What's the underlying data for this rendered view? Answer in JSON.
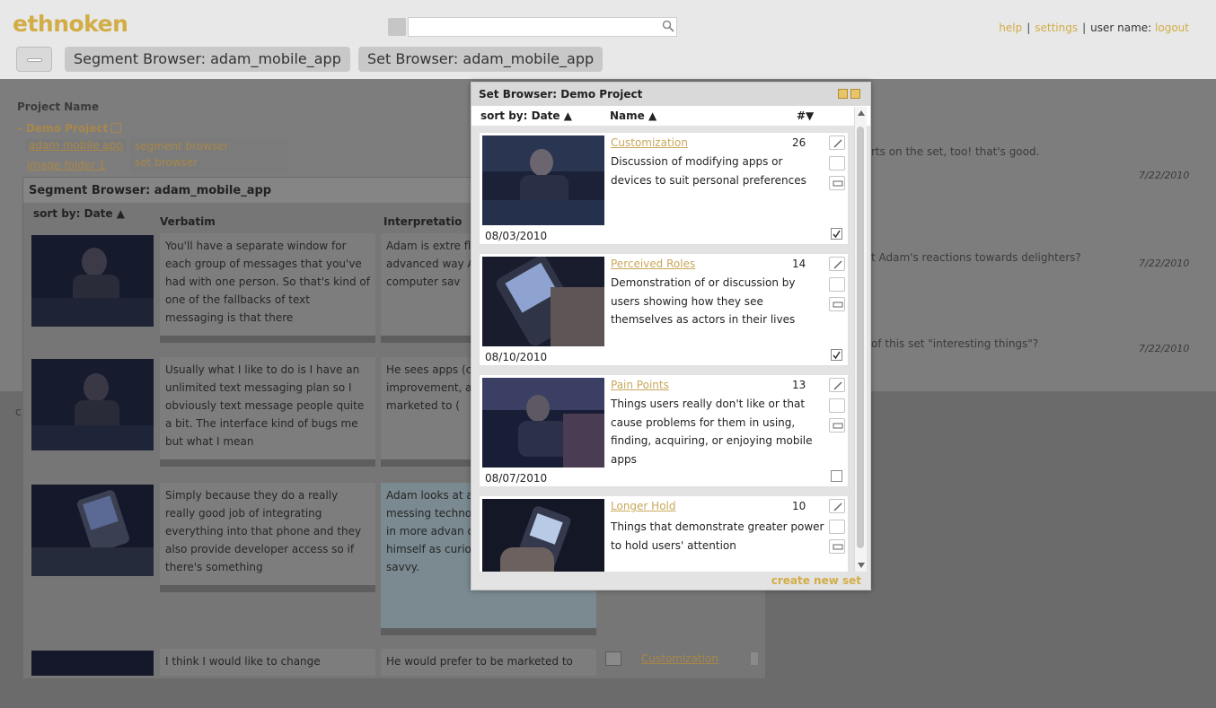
{
  "header": {
    "logo": "ethnoken",
    "search_placeholder": "",
    "links": {
      "help": "help",
      "settings": "settings",
      "user": "user name:",
      "logout": "logout"
    },
    "tabs": [
      "Segment Browser: adam_mobile_app",
      "Set Browser: adam_mobile_app"
    ]
  },
  "background": {
    "project_name_label": "Project Name",
    "project": "Demo Project",
    "items": [
      "adam mobile app",
      "image folder 1"
    ],
    "context_menu": [
      "segment browser",
      "set browser"
    ],
    "comments": [
      {
        "text": "rts on the set, too! that's good.",
        "date": "7/22/2010"
      },
      {
        "text": "t Adam's reactions towards delighters?",
        "date": "7/22/2010"
      },
      {
        "text": "of this set \"interesting things\"?",
        "date": "7/22/2010"
      }
    ],
    "stray_letter": "c"
  },
  "segment_browser": {
    "title": "Segment Browser: adam_mobile_app",
    "sort_label": "sort by: Date ▲",
    "col_verbatim": "Verbatim",
    "col_interpretation": "Interpretatio",
    "rows": [
      {
        "verbatim": "You'll have a separate window for each group of messages that you've had with one person. So that's kind of one of the fallbacks of text messaging is that there",
        "interpretation": "Adam is extre fluent and inte advanced way Adam sees hi computer sav"
      },
      {
        "verbatim": "Usually what I like to do is I have an unlimited text messaging plan so I obviously text message people quite a bit. The interface kind of bugs me but what I mean",
        "interpretation": "He sees apps (customizable improvement, and how he m marketed to ("
      },
      {
        "verbatim": "Simply because they do a really really good job of integrating everything into that phone and they also provide developer access so if there's something",
        "interpretation": "Adam looks at app and discu about messing technology ha technological in more advan devices. Adam sees himself as curious and computer savvy."
      },
      {
        "verbatim": "I think I would like to change",
        "interpretation": "He would prefer to be marketed to",
        "set": "Customization"
      }
    ]
  },
  "set_browser": {
    "title": "Set Browser: Demo Project",
    "sort_label": "sort by: Date ▲",
    "name_label": "Name ▲",
    "count_label": "#▼",
    "create_label": "create new set",
    "sets": [
      {
        "name": "Customization",
        "count": "26",
        "date": "08/03/2010",
        "description": "Discussion of modifying apps or devices to suit personal preferences",
        "checked": true
      },
      {
        "name": "Perceived Roles",
        "count": "14",
        "date": "08/10/2010",
        "description": "Demonstration of or discussion by users showing how they see themselves as actors in their lives",
        "checked": true
      },
      {
        "name": "Pain Points",
        "count": "13",
        "date": "08/07/2010",
        "description": "Things users really don't like or that cause problems for them in using, finding, acquiring, or enjoying mobile apps",
        "checked": false
      },
      {
        "name": "Longer Hold",
        "count": "10",
        "date": "",
        "description": "Things that demonstrate greater power to hold users' attention",
        "checked": false
      }
    ]
  },
  "colors": {
    "accent": "#d2ad46",
    "link": "#c8a85b",
    "dim": "#6b6b6b"
  }
}
